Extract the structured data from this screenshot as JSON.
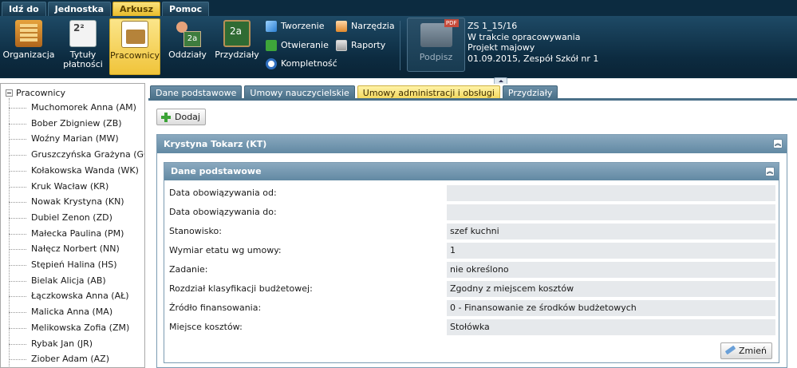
{
  "menubar": {
    "items": [
      "Idź do",
      "Jednostka",
      "Arkusz",
      "Pomoc"
    ],
    "active_index": 2
  },
  "ribbon": {
    "buttons": [
      {
        "label": "Organizacja",
        "icon": "organization-icon"
      },
      {
        "label": "Tytuły płatności",
        "icon": "payment-titles-icon"
      },
      {
        "label": "Pracownicy",
        "icon": "employees-icon",
        "active": true
      },
      {
        "label": "Oddziały",
        "icon": "classes-icon"
      },
      {
        "label": "Przydziały",
        "icon": "assignments-icon"
      }
    ],
    "small_buttons": [
      {
        "label": "Tworzenie",
        "icon": "create-icon"
      },
      {
        "label": "Otwieranie",
        "icon": "open-icon"
      },
      {
        "label": "Kompletność",
        "icon": "completeness-icon"
      },
      {
        "label": "Narzędzia",
        "icon": "tools-icon"
      },
      {
        "label": "Raporty",
        "icon": "reports-icon"
      }
    ],
    "sign_button": {
      "label": "Podpisz",
      "icon": "print-pdf-icon"
    },
    "doc_info": {
      "line1": "ZS 1_15/16",
      "line2": "W trakcie opracowywania",
      "line3": "Projekt majowy",
      "line4": "01.09.2015, Zespół Szkół nr 1"
    }
  },
  "tree": {
    "root": "Pracownicy",
    "items": [
      "Muchomorek Anna (AM)",
      "Bober Zbigniew (ZB)",
      "Woźny Marian (MW)",
      "Gruszczyńska Grażyna (GG)",
      "Kołakowska Wanda (WK)",
      "Kruk Wacław (KR)",
      "Nowak Krystyna (KN)",
      "Dubiel Zenon (ZD)",
      "Małecka Paulina (PM)",
      "Nałęcz Norbert (NN)",
      "Stępień Halina (HS)",
      "Bielak Alicja (AB)",
      "Łączkowska Anna (AŁ)",
      "Malicka Anna (MA)",
      "Melikowska Zofia (ZM)",
      "Rybak Jan (JR)",
      "Ziober Adam (AZ)"
    ]
  },
  "tabs": [
    {
      "label": "Dane podstawowe"
    },
    {
      "label": "Umowy nauczycielskie"
    },
    {
      "label": "Umowy administracji i obsługi",
      "active": true
    },
    {
      "label": "Przydziały"
    }
  ],
  "add_button": "Dodaj",
  "panel": {
    "title": "Krystyna Tokarz (KT)",
    "section": {
      "title": "Dane podstawowe",
      "fields": [
        {
          "label": "Data obowiązywania od:",
          "value": ""
        },
        {
          "label": "Data obowiązywania do:",
          "value": ""
        },
        {
          "label": "Stanowisko:",
          "value": "szef kuchni"
        },
        {
          "label": "Wymiar etatu wg umowy:",
          "value": "1"
        },
        {
          "label": "Zadanie:",
          "value": "nie określono"
        },
        {
          "label": "Rozdział klasyfikacji budżetowej:",
          "value": "Zgodny z miejscem kosztów"
        },
        {
          "label": "Źródło finansowania:",
          "value": "0 - Finansowanie ze środków budżetowych"
        },
        {
          "label": "Miejsce kosztów:",
          "value": "Stołówka"
        }
      ],
      "edit_button": "Zmień"
    }
  }
}
